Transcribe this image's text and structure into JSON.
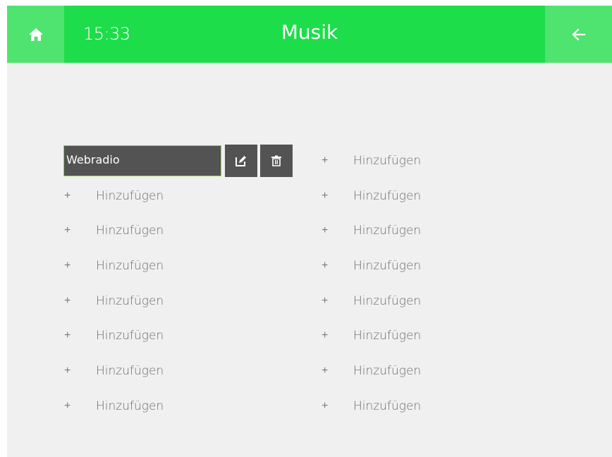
{
  "header": {
    "time": "15:33",
    "title": "Musik",
    "home_icon": "home-icon",
    "back_icon": "arrow-left-icon",
    "bar_color": "#1ddd4b",
    "button_color": "#4fe36f"
  },
  "entries": {
    "left": {
      "first": {
        "name": "Webradio",
        "edit_icon": "edit-icon",
        "delete_icon": "trash-icon"
      },
      "add_slots": [
        {
          "plus": "+",
          "label": "Hinzufügen"
        },
        {
          "plus": "+",
          "label": "Hinzufügen"
        },
        {
          "plus": "+",
          "label": "Hinzufügen"
        },
        {
          "plus": "+",
          "label": "Hinzufügen"
        },
        {
          "plus": "+",
          "label": "Hinzufügen"
        },
        {
          "plus": "+",
          "label": "Hinzufügen"
        },
        {
          "plus": "+",
          "label": "Hinzufügen"
        }
      ]
    },
    "right": {
      "add_slots": [
        {
          "plus": "+",
          "label": "Hinzufügen"
        },
        {
          "plus": "+",
          "label": "Hinzufügen"
        },
        {
          "plus": "+",
          "label": "Hinzufügen"
        },
        {
          "plus": "+",
          "label": "Hinzufügen"
        },
        {
          "plus": "+",
          "label": "Hinzufügen"
        },
        {
          "plus": "+",
          "label": "Hinzufügen"
        },
        {
          "plus": "+",
          "label": "Hinzufügen"
        },
        {
          "plus": "+",
          "label": "Hinzufügen"
        }
      ]
    }
  }
}
